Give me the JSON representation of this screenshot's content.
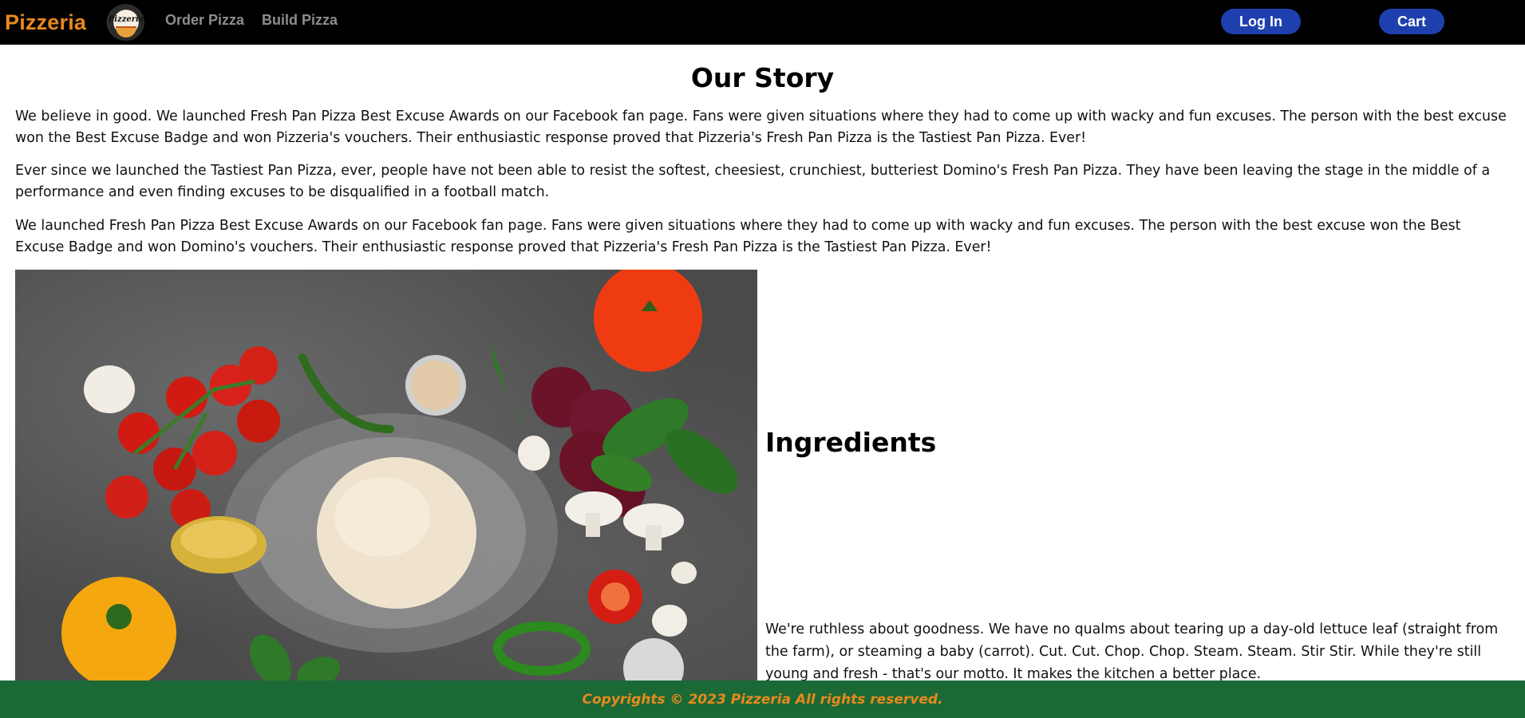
{
  "navbar": {
    "brand": "Pizzeria",
    "logo_text": "Pizzeria",
    "links": [
      {
        "label": "Order Pizza"
      },
      {
        "label": "Build Pizza"
      }
    ],
    "login_label": "Log In",
    "cart_label": "Cart"
  },
  "story": {
    "title": "Our Story",
    "paragraphs": [
      "We believe in good. We launched Fresh Pan Pizza Best Excuse Awards on our Facebook fan page. Fans were given situations where they had to come up with wacky and fun excuses. The person with the best excuse won the Best Excuse Badge and won Pizzeria's vouchers. Their enthusiastic response proved that Pizzeria's Fresh Pan Pizza is the Tastiest Pan Pizza. Ever!",
      "Ever since we launched the Tastiest Pan Pizza, ever, people have not been able to resist the softest, cheesiest, crunchiest, butteriest Domino's Fresh Pan Pizza. They have been leaving the stage in the middle of a performance and even finding excuses to be disqualified in a football match.",
      "We launched Fresh Pan Pizza Best Excuse Awards on our Facebook fan page. Fans were given situations where they had to come up with wacky and fun excuses. The person with the best excuse won the Best Excuse Badge and won Domino's vouchers. Their enthusiastic response proved that Pizzeria's Fresh Pan Pizza is the Tastiest Pan Pizza. Ever!"
    ]
  },
  "ingredients": {
    "title": "Ingredients",
    "text": "We're ruthless about goodness. We have no qualms about tearing up a day-old lettuce leaf (straight from the farm), or steaming a baby (carrot). Cut. Cut. Chop. Chop. Steam. Steam. Stir Stir. While they're still young and fresh - that's our motto. It makes the kitchen a better place."
  },
  "footer": {
    "text": "Copyrights © 2023 Pizzeria All rights reserved."
  },
  "colors": {
    "brand_orange": "#e8891c",
    "nav_bg": "#000000",
    "button_blue": "#1e3fae",
    "footer_green": "#1b6a36"
  }
}
